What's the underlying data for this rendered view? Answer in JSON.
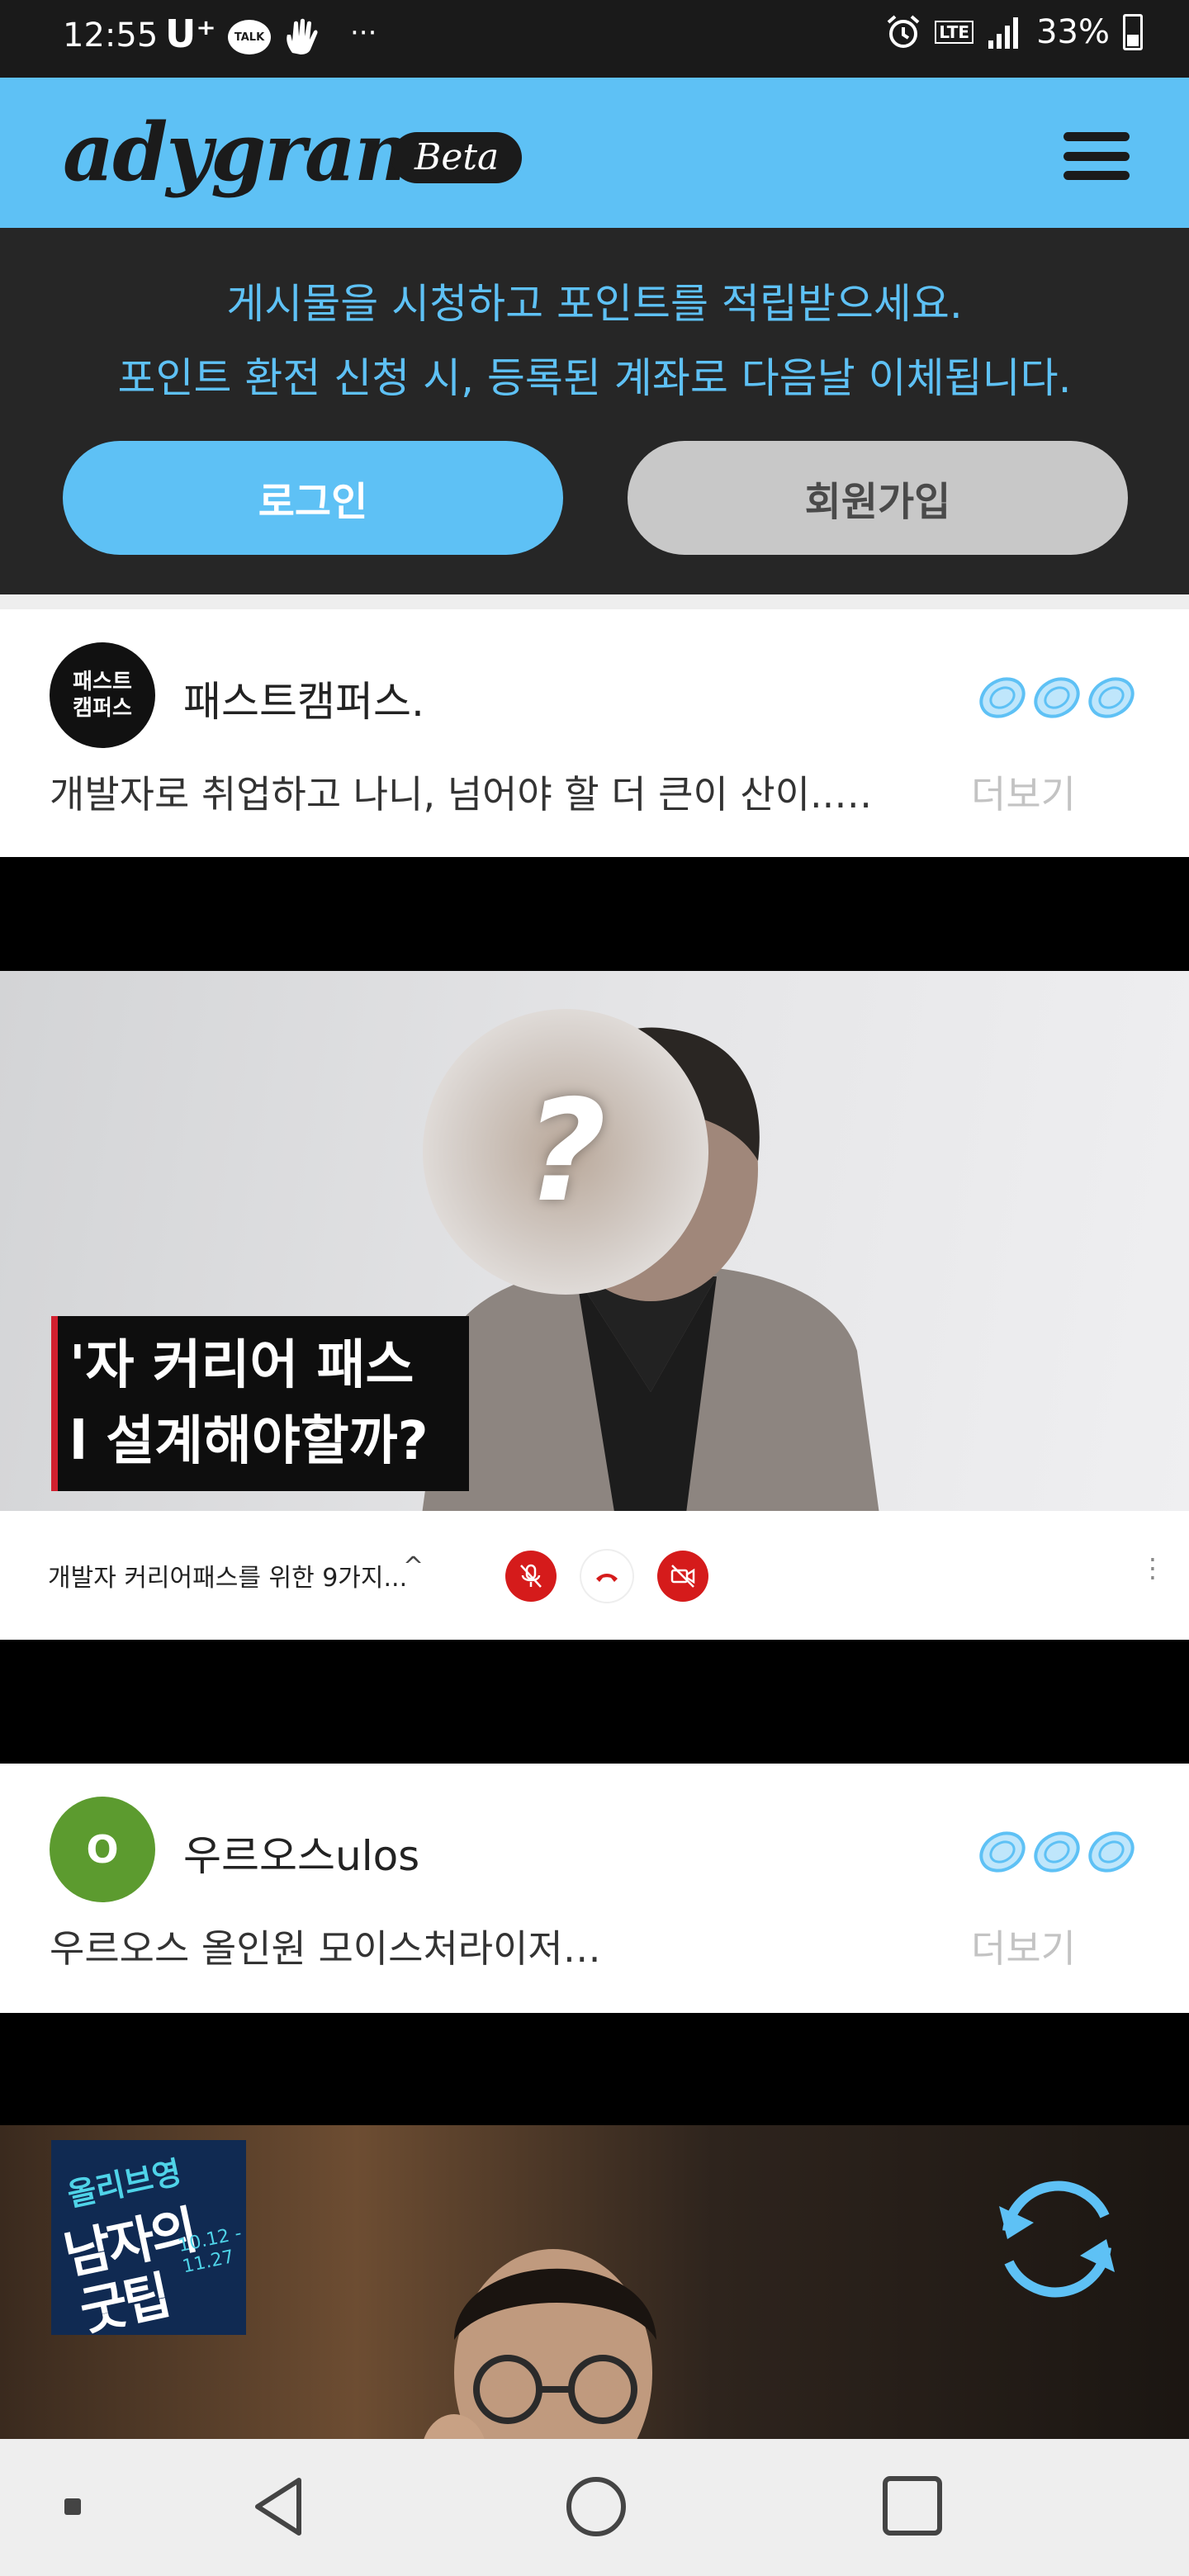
{
  "status_bar": {
    "time": "12:55",
    "carrier": "U⁺",
    "talk_badge": "TALK",
    "dots": "···",
    "network": "LTE",
    "battery": "33%"
  },
  "header": {
    "logo": "adygram",
    "badge": "Beta"
  },
  "banner": {
    "line1": "게시물을 시청하고 포인트를 적립받으세요.",
    "line2": "포인트 환전 신청 시, 등록된 계좌로 다음날 이체됩니다.",
    "login_label": "로그인",
    "signup_label": "회원가입"
  },
  "posts": [
    {
      "avatar_line1": "패스트",
      "avatar_line2": "캠퍼스",
      "author": "패스트캠퍼스.",
      "text": "개발자로 취업하고 나니, 넘어야 할 더 큰이 산이..…",
      "more_label": "더보기",
      "video": {
        "caption_line1": "'자 커리어 패스",
        "caption_line2": "l 설계해야할까?",
        "face_mark": "?",
        "title": "개발자 커리어패스를 위한 9가지...",
        "chevron": "^",
        "menu_glyph": "⋮"
      }
    },
    {
      "avatar_letter": "O",
      "author": "우르오스ulos",
      "text": "우르오스 올인원 모이스처라이저…",
      "more_label": "더보기",
      "promo": {
        "line1": "올리브영",
        "line2": "남자의",
        "line3": "굿팁",
        "date1": "10.12 -",
        "date2": "11.27"
      }
    }
  ],
  "colors": {
    "accent": "#5ec1f5",
    "dark_bg": "#262626",
    "control_red": "#d51b1b",
    "avatar_green": "#5c9b2f"
  },
  "icons": {
    "menu": "hamburger-icon",
    "coins": "coin-stack-icon",
    "mic_off": "mic-off-icon",
    "hang_up": "phone-hangup-icon",
    "video_off": "video-off-icon",
    "refresh": "refresh-icon"
  }
}
